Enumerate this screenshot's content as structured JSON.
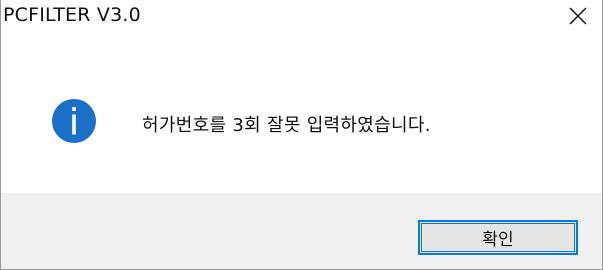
{
  "window": {
    "title": "PCFILTER V3.0",
    "close_icon": "close-icon"
  },
  "body": {
    "icon": "info-icon",
    "icon_color": "#1a6fc9",
    "message": "허가번호를 3회 잘못 입력하였습니다."
  },
  "footer": {
    "ok_label": "확인",
    "accent_color": "#0a78d7"
  }
}
